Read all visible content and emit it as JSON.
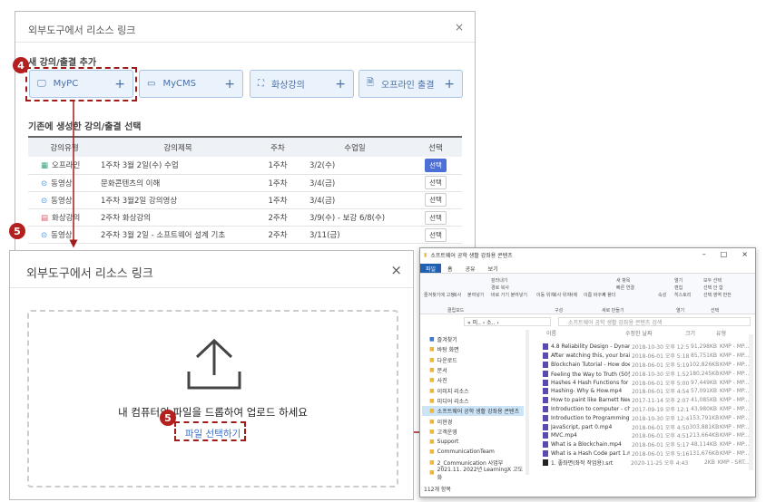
{
  "top_dialog": {
    "title": "외부도구에서 리소스 링크",
    "close": "×",
    "add_section": "새 강의/출결 추가",
    "add_buttons": [
      {
        "label": "MyPC",
        "icon": "monitor-icon"
      },
      {
        "label": "MyCMS",
        "icon": "cms-icon"
      },
      {
        "label": "화상강의",
        "icon": "video-conference-icon"
      },
      {
        "label": "오프라인 출결",
        "icon": "document-icon"
      }
    ],
    "plus": "+",
    "existing_section": "기존에 생성한 강의/출결 선택",
    "columns": [
      "강의유형",
      "강의제목",
      "주차",
      "수업일",
      "선택"
    ],
    "rows": [
      {
        "type": "오프라인",
        "title": "1주차 3월 2일(수) 수업",
        "week": "1주차",
        "date": "3/2(수)",
        "select": "선택",
        "selected": true
      },
      {
        "type": "동영상",
        "title": "문화콘텐츠의 이해",
        "week": "1주차",
        "date": "3/4(금)",
        "select": "선택",
        "selected": false
      },
      {
        "type": "동영상",
        "title": "1주차 3월2일 강의영상",
        "week": "1주차",
        "date": "3/4(금)",
        "select": "선택",
        "selected": false
      },
      {
        "type": "화상강의",
        "title": "2주차 화상강의",
        "week": "2주차",
        "date": "3/9(수) - 보강 6/8(수)",
        "select": "선택",
        "selected": false
      },
      {
        "type": "동영상",
        "title": "2주차 3월 2일 - 소프트웨어 설계 기초",
        "week": "2주차",
        "date": "3/11(금)",
        "select": "선택",
        "selected": false
      }
    ]
  },
  "badges": {
    "step4": "4",
    "step5a": "5",
    "step5b": "5"
  },
  "upload_dialog": {
    "title": "외부도구에서 리소스 링크",
    "close": "×",
    "drop_text": "내 컴퓨터의 파일을 드롭하여 업로드 하세요",
    "select_link": "파일 선택하기"
  },
  "explorer": {
    "title": "소프트웨어 공학 생활 강좌용 콘텐츠",
    "tabs": [
      "파일",
      "홈",
      "공유",
      "보기"
    ],
    "ribbon_groups": [
      "클립보드",
      "구성",
      "새로 만들기",
      "열기",
      "선택"
    ],
    "ribbon_items": [
      "즐겨찾기에 고정",
      "복사",
      "붙여넣기",
      "잘라내기",
      "경로 복사",
      "바로 가기 붙여넣기",
      "이동 위치",
      "복사 위치",
      "삭제",
      "이름 바꾸기",
      "새 폴더",
      "새 항목",
      "빠른 연결",
      "속성",
      "열기",
      "편집",
      "히스토리",
      "모두 선택",
      "선택 안 함",
      "선택 영역 반전"
    ],
    "address": "« 미.. › 소.. ›",
    "search_placeholder": "소프트웨어 공학 생활 강좌용 콘텐츠 검색",
    "nav": [
      "즐겨찾기",
      "바탕 화면",
      "다운로드",
      "문서",
      "사진",
      "이미지 리소스",
      "미디어 리소스",
      "소프트웨어 공학 생활 강좌용 콘텐츠",
      "이현경",
      "고객운영",
      "Support",
      "CommunicationTeam",
      "2_Communication 사업부",
      "2021.11. 2022년 LearningX 고도화"
    ],
    "columns": [
      "이름",
      "수정한 날짜",
      "크기",
      "유형"
    ],
    "files": [
      [
        "4.8 Reliability Design - Dynamic Prog...",
        "2018-10-30 오후 12:55",
        "91,298KB",
        "KMP - MP..."
      ],
      [
        "After watching this, your brain will n...",
        "2018-06-01 오후 5:18",
        "85,751KB",
        "KMP - MP..."
      ],
      [
        "Blockchain Tutorial - How does a Bl...",
        "2018-06-01 오후 5:19",
        "102,826KB",
        "KMP - MP..."
      ],
      [
        "Feeling the Way to Truth (50분).mp4",
        "2018-10-30 오후 1:52",
        "180,245KB",
        "KMP - MP..."
      ],
      [
        "Hashes 4  Hash Functions for Strings...",
        "2018-06-01 오후 5:00",
        "97,449KB",
        "KMP - MP..."
      ],
      [
        "Hashing- Why & How.mp4",
        "2018-06-01 오후 4:54",
        "57,091KB",
        "KMP - MP..."
      ],
      [
        "How to paint like Barnett Newman -...",
        "2017-11-14 오후 2:07",
        "41,085KB",
        "KMP - MP..."
      ],
      [
        "Introduction to computer - chapter 1...",
        "2017-09-19 오후 12:15",
        "43,980KB",
        "KMP - MP..."
      ],
      [
        "Introduction to Programming.mp4",
        "2018-10-30 오후 12:41",
        "153,791KB",
        "KMP - MP..."
      ],
      [
        "JavaScript, part 0.mp4",
        "2018-06-01 오후 4:50",
        "303,881KB",
        "KMP - MP..."
      ],
      [
        "MVC.mp4",
        "2018-06-01 오후 4:51",
        "213,664KB",
        "KMP - MP..."
      ],
      [
        "What is a Blockchain.mp4",
        "2018-06-01 오후 5:17",
        "48,114KB",
        "KMP - MP..."
      ],
      [
        "What is a Hash Code part 1.mp4",
        "2018-06-01 오후 5:16",
        "131,676KB",
        "KMP - MP..."
      ],
      [
        "1. 좋좌면(좌작 작업용).srt",
        "2020-11-25 오후 4:43",
        "2KB",
        "KMP - SRT..."
      ]
    ],
    "status": "112개 항목"
  },
  "colors": {
    "accent_red": "#b3201e",
    "button_blue": "#4b6fd6",
    "link_blue": "#3b6fd0"
  }
}
